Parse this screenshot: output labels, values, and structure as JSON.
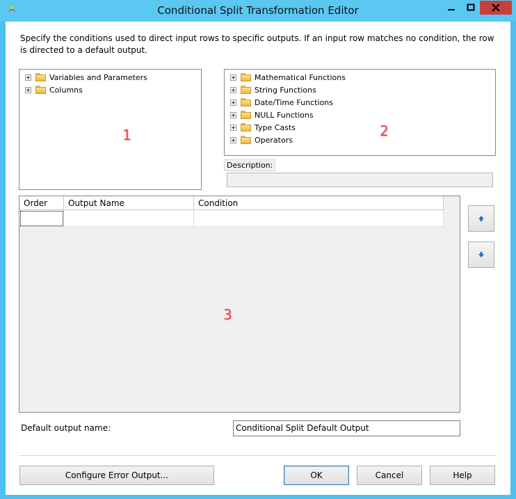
{
  "window": {
    "title": "Conditional Split Transformation Editor",
    "icon": "ssis-transform-icon",
    "controls": [
      "minimize-icon",
      "maximize-icon",
      "close-icon"
    ]
  },
  "description": "Specify the conditions used to direct input rows to specific outputs. If an input row matches no condition, the row is directed to a default output.",
  "left_tree": {
    "items": [
      {
        "label": "Variables and Parameters"
      },
      {
        "label": "Columns"
      }
    ],
    "marker": "1"
  },
  "right_tree": {
    "items": [
      {
        "label": "Mathematical Functions"
      },
      {
        "label": "String Functions"
      },
      {
        "label": "Date/Time Functions"
      },
      {
        "label": "NULL Functions"
      },
      {
        "label": "Type Casts"
      },
      {
        "label": "Operators"
      }
    ],
    "marker": "2"
  },
  "description_panel": {
    "label": "Description:",
    "value": ""
  },
  "grid": {
    "columns": [
      "Order",
      "Output Name",
      "Condition"
    ],
    "marker": "3"
  },
  "default_output": {
    "label": "Default output name:",
    "value": "Conditional Split Default Output"
  },
  "buttons": {
    "configure_error": "Configure Error Output...",
    "ok": "OK",
    "cancel": "Cancel",
    "help": "Help"
  },
  "colors": {
    "titlebar": "#5bc8f2",
    "close": "#c7403a",
    "marker": "#e8474a"
  }
}
